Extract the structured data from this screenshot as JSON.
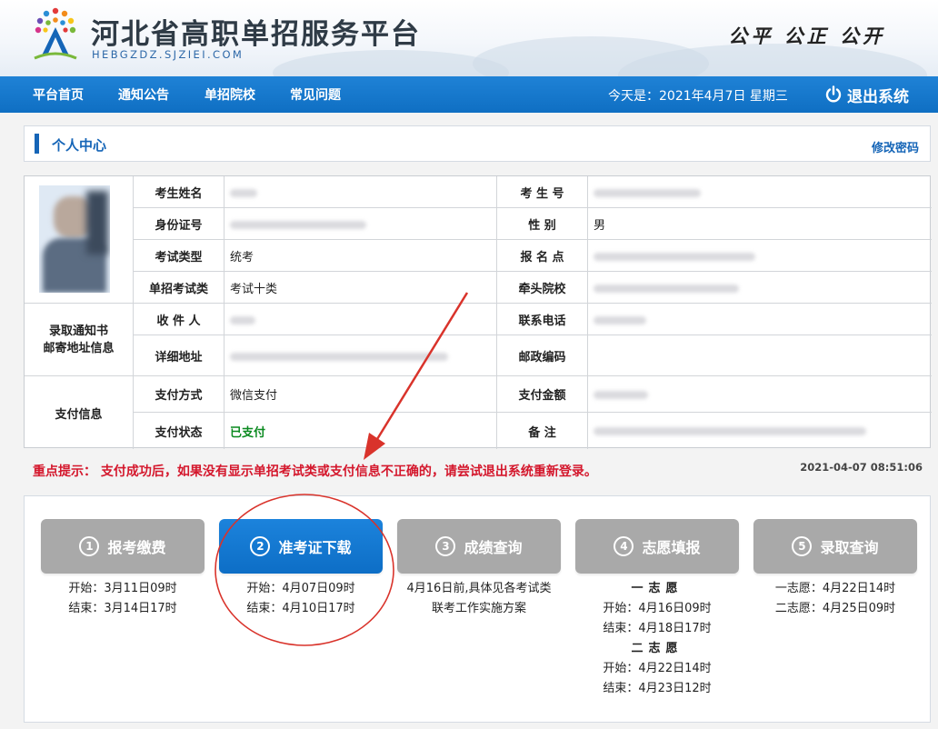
{
  "header": {
    "site_title": "河北省高职单招服务平台",
    "site_domain": "HEBGZDZ.SJZIEI.COM",
    "slogan": "公平  公正  公开"
  },
  "nav": {
    "items": [
      "平台首页",
      "通知公告",
      "单招院校",
      "常见问题"
    ],
    "date_text": "今天是：2021年4月7日 星期三",
    "logout_label": "退出系统"
  },
  "personal_center": {
    "title": "个人中心",
    "change_password": "修改密码"
  },
  "info": {
    "rows": [
      {
        "label": "考生姓名",
        "value": "",
        "label2": "考 生 号",
        "value2": ""
      },
      {
        "label": "身份证号",
        "value": "",
        "label2": "性    别",
        "value2": "男"
      },
      {
        "label": "考试类型",
        "value": "统考",
        "label2": "报 名 点",
        "value2": ""
      },
      {
        "label": "单招考试类",
        "value": "考试十类",
        "label2": "牵头院校",
        "value2": ""
      },
      {
        "label": "收 件 人",
        "value": "",
        "label2": "联系电话",
        "value2": ""
      },
      {
        "label": "详细地址",
        "value": "",
        "label2": "邮政编码",
        "value2": ""
      },
      {
        "label": "支付方式",
        "value": "微信支付",
        "label2": "支付金额",
        "value2": ""
      },
      {
        "label": "支付状态",
        "value": "已支付",
        "label2": "备    注",
        "value2": ""
      }
    ],
    "section_mail": "录取通知书\n邮寄地址信息",
    "section_pay": "支付信息"
  },
  "notice": {
    "text": "重点提示： 支付成功后，如果没有显示单招考试类或支付信息不正确的，请尝试退出系统重新登录。",
    "time": "2021-04-07 08:51:06"
  },
  "steps": [
    {
      "num": "1",
      "label": "报考缴费",
      "lines": [
        "开始：3月11日09时",
        "结束：3月14日17时"
      ]
    },
    {
      "num": "2",
      "label": "准考证下载",
      "lines": [
        "开始：4月07日09时",
        "结束：4月10日17时"
      ]
    },
    {
      "num": "3",
      "label": "成绩查询",
      "lines": [
        "4月16日前,具体见各考试类",
        "联考工作实施方案"
      ]
    },
    {
      "num": "4",
      "label": "志愿填报",
      "lines": [
        "一志愿",
        "开始：4月16日09时",
        "结束：4月18日17时",
        "二志愿",
        "开始：4月22日14时",
        "结束：4月23日12时"
      ]
    },
    {
      "num": "5",
      "label": "录取查询",
      "lines": [
        "一志愿：4月22日14时",
        "二志愿：4月25日09时"
      ]
    }
  ],
  "colors": {
    "accent": "#0f6fc3",
    "notice": "#d4172c",
    "paid": "#0b8a20",
    "annotation": "#d9332b"
  }
}
